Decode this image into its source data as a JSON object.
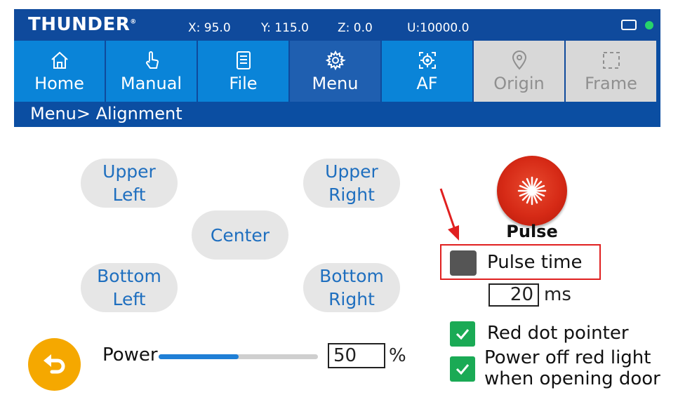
{
  "status": {
    "logo": "THUNDER",
    "logo_mark": "®",
    "x": "X:  95.0",
    "y": "Y:  115.0",
    "z": "Z:   0.0",
    "u": "U:10000.0"
  },
  "tabs": [
    {
      "label": "Home",
      "icon": "home-icon",
      "state": "normal"
    },
    {
      "label": "Manual",
      "icon": "hand-pointer-icon",
      "state": "normal"
    },
    {
      "label": "File",
      "icon": "file-icon",
      "state": "normal"
    },
    {
      "label": "Menu",
      "icon": "gear-icon",
      "state": "active"
    },
    {
      "label": "AF",
      "icon": "crosshair-icon",
      "state": "normal"
    },
    {
      "label": "Origin",
      "icon": "location-pin-icon",
      "state": "disabled"
    },
    {
      "label": "Frame",
      "icon": "dashed-square-icon",
      "state": "disabled"
    }
  ],
  "breadcrumb": "Menu> Alignment",
  "alignment": {
    "upper_left": [
      "Upper",
      "Left"
    ],
    "upper_right": [
      "Upper",
      "Right"
    ],
    "center": "Center",
    "bottom_left": [
      "Bottom",
      "Left"
    ],
    "bottom_right": [
      "Bottom",
      "Right"
    ]
  },
  "pulse": {
    "label": "Pulse",
    "pulse_time_label": "Pulse time",
    "pulse_time_value": "20",
    "pulse_time_unit": "ms"
  },
  "options": {
    "red_dot": "Red dot pointer",
    "power_off_line1": "Power off red light",
    "power_off_line2": "when opening door"
  },
  "power": {
    "label": "Power",
    "value": "50",
    "unit": "%",
    "slider_fraction": 0.5
  },
  "colors": {
    "header": "#0f4a9c",
    "tab": "#0a84d8",
    "tab_active": "#1f5fb0",
    "accent_text": "#1f6fbf",
    "pulse_red": "#d62a16",
    "check_green": "#1aaa55",
    "undo_orange": "#f5a800",
    "highlight_red": "#e02020"
  }
}
